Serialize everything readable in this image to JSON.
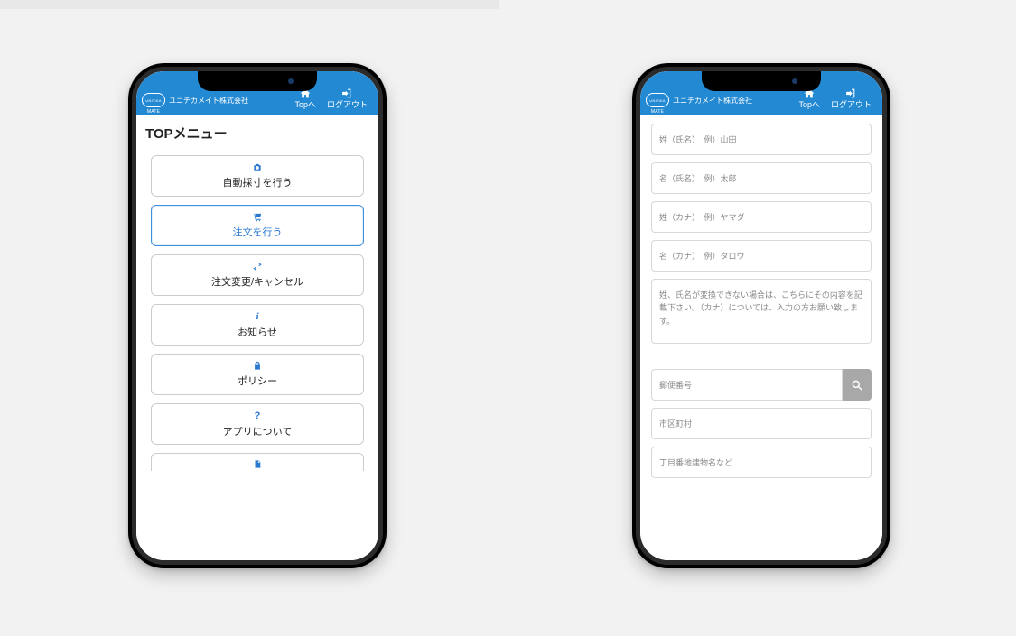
{
  "brand": {
    "logo_text": "UNITIKA",
    "name": "ユニチカメイト株式会社"
  },
  "nav": {
    "top_label": "Topへ",
    "logout_label": "ログアウト"
  },
  "left": {
    "title": "TOPメニュー",
    "items": [
      {
        "label": "自動採寸を行う"
      },
      {
        "label": "注文を行う"
      },
      {
        "label": "注文変更/キャンセル"
      },
      {
        "label": "お知らせ"
      },
      {
        "label": "ポリシー"
      },
      {
        "label": "アプリについて"
      }
    ]
  },
  "right": {
    "fields": {
      "sei_ph": "姓（氏名）　例）山田",
      "mei_ph": "名（氏名）　例）太郎",
      "sei_kana_ph": "姓（カナ）　例）ヤマダ",
      "mei_kana_ph": "名（カナ）　例）タロウ",
      "note_ph": "姓、氏名が変換できない場合は、こちらにその内容を記載下さい。（カナ）については、入力の方お願い致します。",
      "zip_ph": "郵便番号",
      "city_ph": "市区町村",
      "addr_ph": "丁目番地建物名など"
    }
  }
}
